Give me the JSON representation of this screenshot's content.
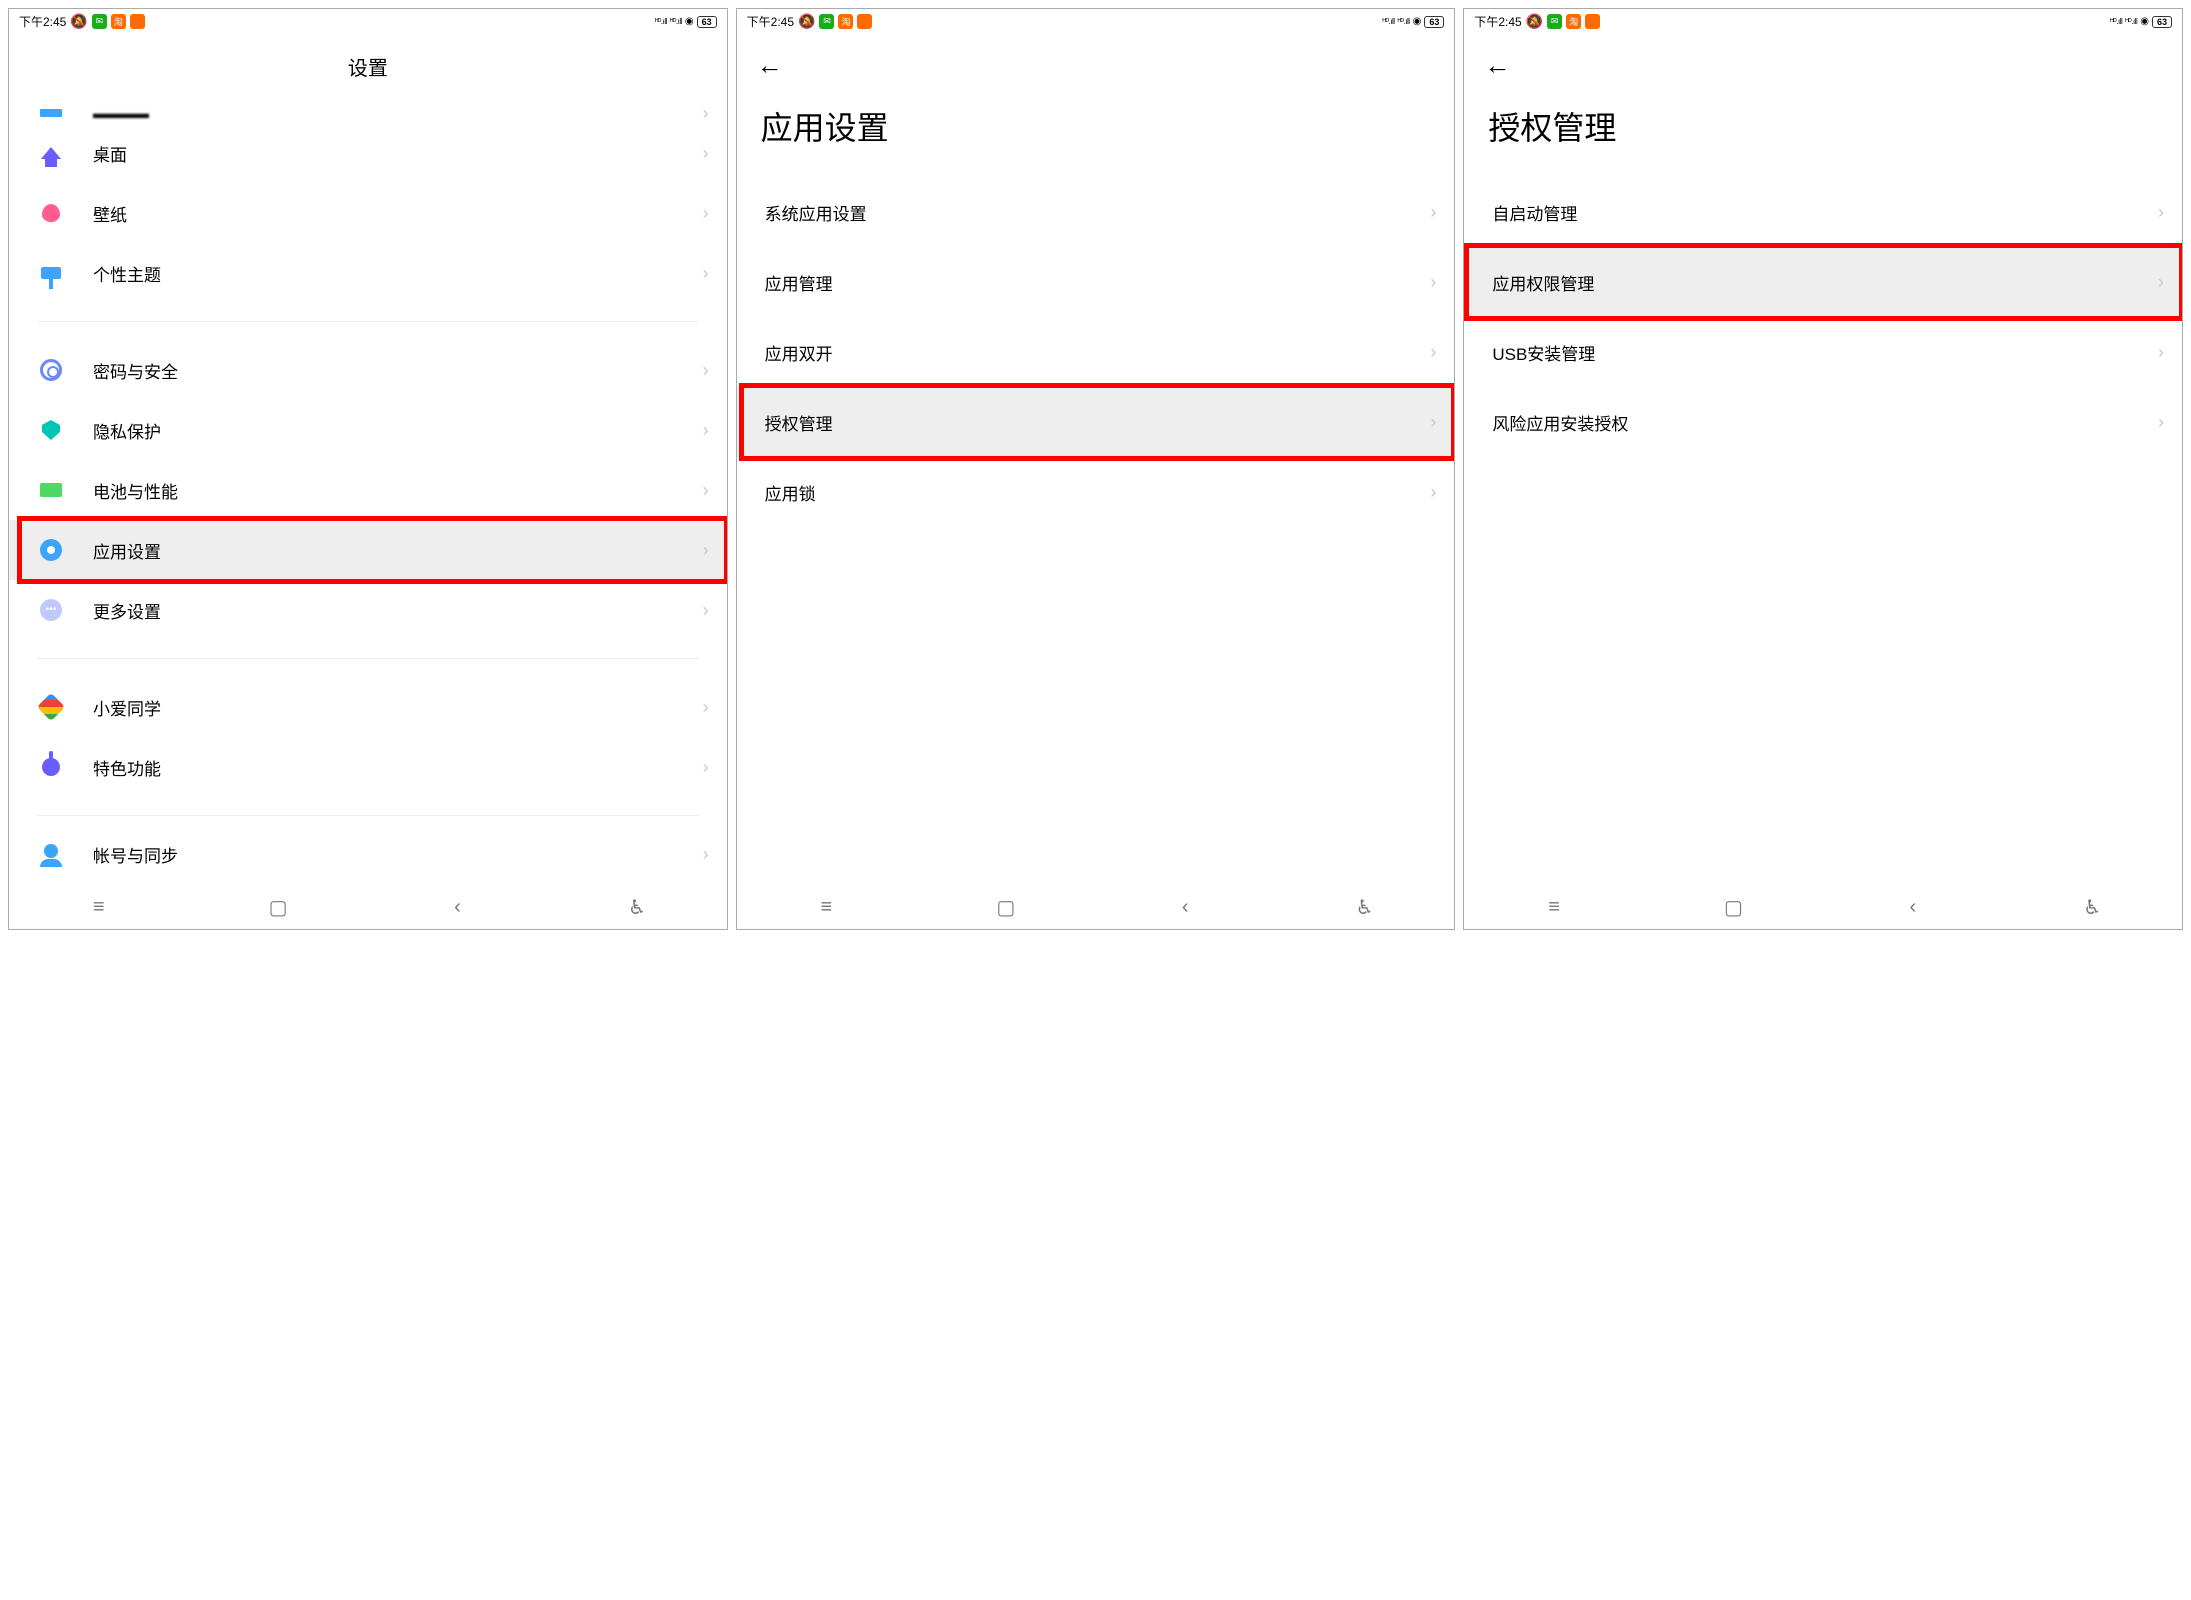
{
  "status": {
    "time": "下午2:45",
    "battery": "63"
  },
  "screen1": {
    "title": "设置",
    "items": {
      "cut": "~~~~",
      "desktop": "桌面",
      "wallpaper": "壁纸",
      "theme": "个性主题",
      "password": "密码与安全",
      "privacy": "隐私保护",
      "batteryperf": "电池与性能",
      "appsettings": "应用设置",
      "more": "更多设置",
      "xiaoai": "小爱同学",
      "special": "特色功能",
      "account": "帐号与同步"
    }
  },
  "screen2": {
    "title": "应用设置",
    "items": {
      "system": "系统应用设置",
      "manage": "应用管理",
      "dual": "应用双开",
      "auth": "授权管理",
      "lock": "应用锁"
    }
  },
  "screen3": {
    "title": "授权管理",
    "items": {
      "autostart": "自启动管理",
      "perm": "应用权限管理",
      "usb": "USB安装管理",
      "risk": "风险应用安装授权"
    }
  }
}
